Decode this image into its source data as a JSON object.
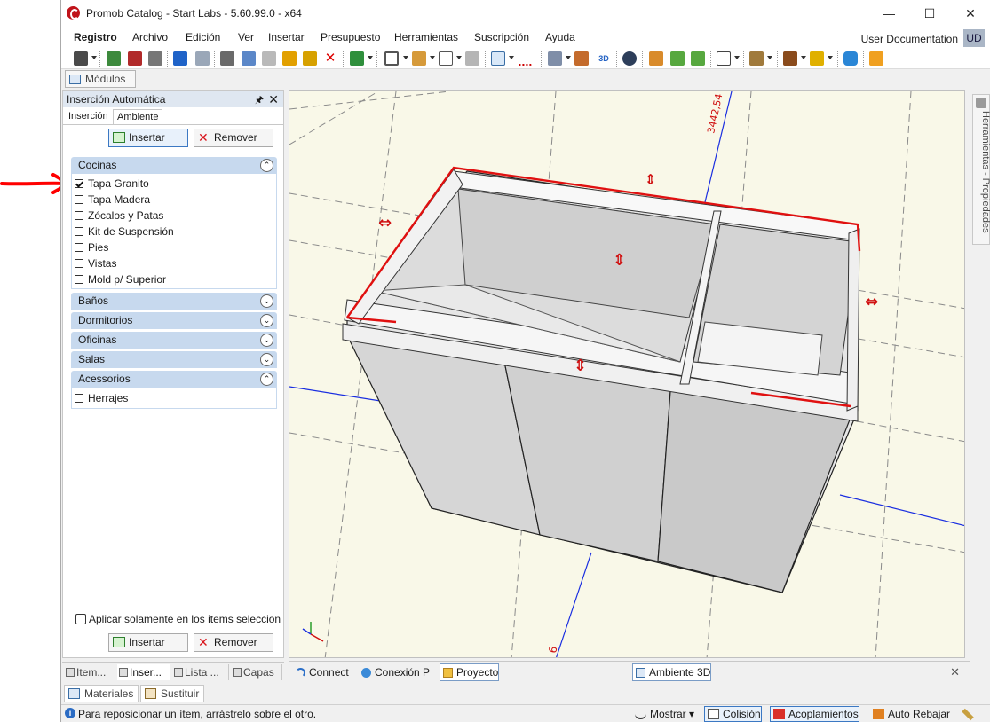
{
  "window": {
    "title": "Promob Catalog - Start Labs - 5.60.99.0 - x64",
    "minimize": "—",
    "maximize": "☐",
    "close": "✕"
  },
  "menu": {
    "items": [
      "Registro",
      "Archivo",
      "Edición",
      "Ver",
      "Insertar",
      "Presupuesto",
      "Herramientas",
      "Suscripción",
      "Ayuda"
    ],
    "user_label": "User Documentation",
    "user_initials": "UD"
  },
  "modulos_label": "Módulos",
  "panel": {
    "title": "Inserción Automática",
    "pin": "🖈",
    "close": "✕",
    "tabs": [
      "Inserción",
      "Ambiente"
    ],
    "insert_label": "Insertar",
    "remove_label": "Remover",
    "sections": [
      {
        "label": "Cocinas",
        "expanded": true,
        "items": [
          {
            "label": "Tapa Granito",
            "checked": true
          },
          {
            "label": "Tapa Madera",
            "checked": false
          },
          {
            "label": "Zócalos y Patas",
            "checked": false
          },
          {
            "label": "Kit de Suspensión",
            "checked": false
          },
          {
            "label": "Pies",
            "checked": false
          },
          {
            "label": "Vistas",
            "checked": false
          },
          {
            "label": "Mold p/ Superior",
            "checked": false
          }
        ]
      },
      {
        "label": "Baños",
        "expanded": false
      },
      {
        "label": "Dormitorios",
        "expanded": false
      },
      {
        "label": "Oficinas",
        "expanded": false
      },
      {
        "label": "Salas",
        "expanded": false
      },
      {
        "label": "Acessorios",
        "expanded": true,
        "items": [
          {
            "label": "Herrajes",
            "checked": false
          }
        ]
      }
    ],
    "apply_selected_label": "Aplicar solamente en los items seleccionad",
    "bottom_tabs": [
      "Item...",
      "Inser...",
      "Lista ...",
      "Capas"
    ]
  },
  "view": {
    "dimension_label": "3442,54",
    "axis_mark": "6",
    "tabs": [
      "Connect",
      "Conexión P",
      "Proyecto",
      "Ambiente 3D"
    ],
    "close": "✕"
  },
  "right_dock_label": "Herramientas - Propiedades",
  "material_tabs": [
    "Materiales",
    "Sustituir"
  ],
  "status": {
    "message": "Para reposicionar un ítem, arrástrelo sobre el otro.",
    "mostrar": "Mostrar",
    "colision": "Colisión",
    "acoplamientos": "Acoplamientos",
    "auto_rebajar": "Auto Rebajar"
  },
  "colors": {
    "selection_red": "#e01010",
    "axis_blue": "#1a2ee0",
    "cabinet_fill": "#e4e4e4",
    "viewport_bg": "#f9f8e8"
  },
  "icons": [
    "save-icon",
    "print-icon",
    "undo-icon",
    "redo-icon",
    "cut-icon",
    "copy-icon",
    "paste-icon",
    "delete-icon",
    "budget-icon",
    "select-icon",
    "eye-icon",
    "3d-icon",
    "chat-icon",
    "user-icon"
  ]
}
